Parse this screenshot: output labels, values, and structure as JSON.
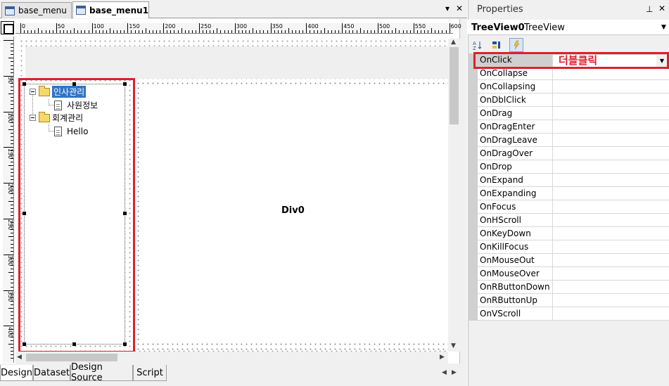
{
  "document_tabs": [
    {
      "label": "base_menu",
      "active": false
    },
    {
      "label": "base_menu1 *",
      "active": true
    }
  ],
  "tab_controls": {
    "dropdown": "▾",
    "close": "✕"
  },
  "ruler": {
    "horizontal": [
      "0",
      "50",
      "100",
      "150",
      "200",
      "250",
      "300",
      "350",
      "400",
      "450",
      "500",
      "550",
      "600"
    ],
    "vertical": [
      "50",
      "100",
      "150",
      "200",
      "250",
      "300",
      "350",
      "400"
    ]
  },
  "treeview": {
    "items": [
      {
        "label": "인사관리",
        "type": "folder",
        "expanded": true,
        "selected": true
      },
      {
        "label": "사원정보",
        "type": "document"
      },
      {
        "label": "회계관리",
        "type": "folder",
        "expanded": true,
        "selected": false
      },
      {
        "label": "Hello",
        "type": "document"
      }
    ]
  },
  "div0_label": "Div0",
  "bottom_tabs": [
    "Design",
    "Dataset",
    "Design Source",
    "Script"
  ],
  "properties": {
    "title": "Properties",
    "pin_icon": "pin-icon",
    "close_icon": "close-icon",
    "object_name": "TreeView0",
    "object_type": "TreeView",
    "toolbar_icons": [
      "sort-alphabetical-icon",
      "categorized-icon",
      "events-icon"
    ],
    "events": [
      {
        "name": "OnClick",
        "value": "더블클릭"
      },
      {
        "name": "OnCollapse",
        "value": ""
      },
      {
        "name": "OnCollapsing",
        "value": ""
      },
      {
        "name": "OnDblClick",
        "value": ""
      },
      {
        "name": "OnDrag",
        "value": ""
      },
      {
        "name": "OnDragEnter",
        "value": ""
      },
      {
        "name": "OnDragLeave",
        "value": ""
      },
      {
        "name": "OnDragOver",
        "value": ""
      },
      {
        "name": "OnDrop",
        "value": ""
      },
      {
        "name": "OnExpand",
        "value": ""
      },
      {
        "name": "OnExpanding",
        "value": ""
      },
      {
        "name": "OnFocus",
        "value": ""
      },
      {
        "name": "OnHScroll",
        "value": ""
      },
      {
        "name": "OnKeyDown",
        "value": ""
      },
      {
        "name": "OnKillFocus",
        "value": ""
      },
      {
        "name": "OnMouseOut",
        "value": ""
      },
      {
        "name": "OnMouseOver",
        "value": ""
      },
      {
        "name": "OnRButtonDown",
        "value": ""
      },
      {
        "name": "OnRButtonUp",
        "value": ""
      },
      {
        "name": "OnVScroll",
        "value": ""
      }
    ]
  },
  "colors": {
    "highlight": "#e0202a",
    "selection": "#3174c6"
  }
}
